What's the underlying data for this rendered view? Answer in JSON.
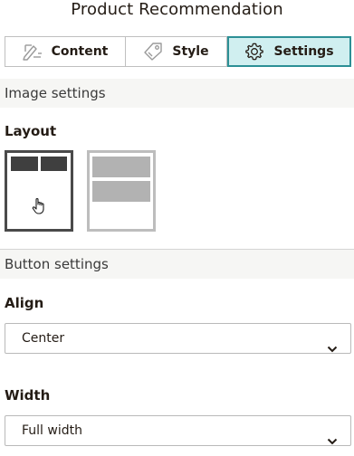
{
  "panel": {
    "title": "Product Recommendation"
  },
  "tabs": [
    {
      "label": "Content",
      "icon": "pencil-ruler-icon",
      "active": false
    },
    {
      "label": "Style",
      "icon": "paint-tag-icon",
      "active": false
    },
    {
      "label": "Settings",
      "icon": "gear-icon",
      "active": true
    }
  ],
  "image_settings": {
    "header": "Image settings",
    "layout_label": "Layout",
    "options": [
      {
        "name": "two-column-grid",
        "selected": true
      },
      {
        "name": "stacked-rows",
        "selected": false
      }
    ]
  },
  "button_settings": {
    "header": "Button settings",
    "align_label": "Align",
    "align_value": "Center",
    "width_label": "Width",
    "width_value": "Full width"
  },
  "colors": {
    "accent": "#2c8f95",
    "active_tab_bg": "#d0eff0",
    "section_bg": "#f6f6f4",
    "selected_border": "#4a4a4a",
    "unselected_border": "#bdbdbd"
  }
}
